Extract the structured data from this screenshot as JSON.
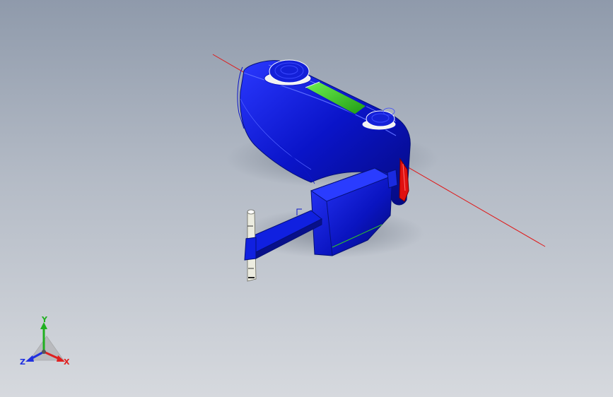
{
  "viewport": {
    "background_top": "#8f9aab",
    "background_bottom": "#d6d9de"
  },
  "model": {
    "body_color": "#0a14c8",
    "screen_color": "#33cc22",
    "accent_color": "#e01010",
    "ruler_color": "#e8e8d8",
    "axis_line_color": "#e01818"
  },
  "triad": {
    "x_label": "X",
    "y_label": "Y",
    "z_label": "Z",
    "x_color": "#e02020",
    "y_color": "#20b020",
    "z_color": "#2030e0"
  }
}
